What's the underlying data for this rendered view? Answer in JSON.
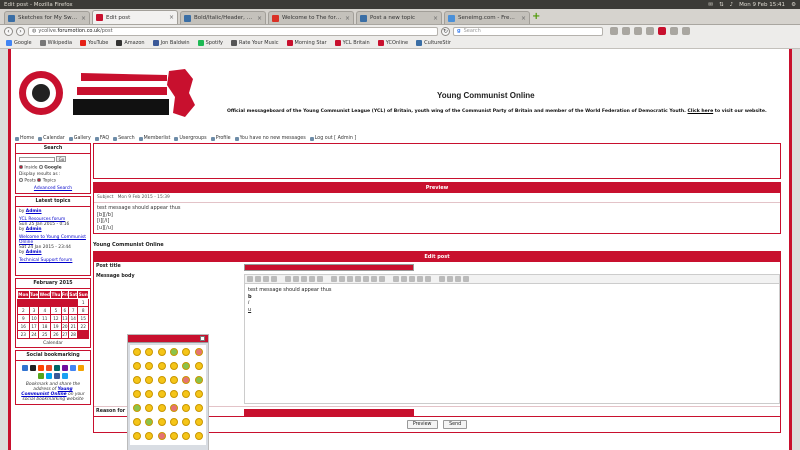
{
  "os": {
    "window_title": "Edit post - Mozilla Firefox",
    "datetime": "Mon 9 Feb 15:41"
  },
  "tabs": [
    {
      "label": "Sketches for My Sweeth...",
      "color": "#3a6ea5"
    },
    {
      "label": "Edit post",
      "color": "#c8102e",
      "active": true
    },
    {
      "label": "Bold/Italic/Header, etc ...",
      "color": "#3a6ea5"
    },
    {
      "label": "Welcome to The forum ...",
      "color": "#d93025"
    },
    {
      "label": "Post a new topic",
      "color": "#3a6ea5"
    },
    {
      "label": "Seneimg.com - Free ima...",
      "color": "#4a90d9"
    }
  ],
  "nav": {
    "url_host": "ycolive.",
    "url_domain": "forumotion.co.uk",
    "url_path": "/post",
    "search_placeholder": "Search"
  },
  "bookmarks": [
    {
      "label": "Google",
      "color": "#4285f4"
    },
    {
      "label": "Wikipedia",
      "color": "#777777"
    },
    {
      "label": "YouTube",
      "color": "#e62117"
    },
    {
      "label": "Amazon",
      "color": "#333333"
    },
    {
      "label": "Jon Baldwin",
      "color": "#3b5998"
    },
    {
      "label": "Spotify",
      "color": "#1db954"
    },
    {
      "label": "Rate Your Music",
      "color": "#555555"
    },
    {
      "label": "Morning Star",
      "color": "#c8102e"
    },
    {
      "label": "YCL Britain",
      "color": "#c8102e"
    },
    {
      "label": "YCOnline",
      "color": "#c8102e"
    },
    {
      "label": "CultureStir",
      "color": "#3a6ea5"
    }
  ],
  "site": {
    "title": "Young Communist Online",
    "desc": "Official messageboard of the Young Communist League (YCL) of Britain, youth wing of the Communist Party of Britain and member of the World Federation of Democratic Youth.",
    "desc_link": "Click here",
    "desc_tail": " to visit our website."
  },
  "menu": [
    "Home",
    "Calendar",
    "Gallery",
    "FAQ",
    "Search",
    "Memberlist",
    "Usergroups",
    "Profile",
    "You have no new messages",
    "Log out [ Admin ]"
  ],
  "sidebar": {
    "search": {
      "title": "Search",
      "go": "Go",
      "inside": "Inside",
      "google": "Google",
      "display": "Display results as :",
      "posts": "Posts",
      "topics": "Topics",
      "advanced": "Advanced Search"
    },
    "latest": {
      "title": "Latest topics",
      "items": [
        {
          "by": "by",
          "user": "Admin",
          "topic": "",
          "date": ""
        },
        {
          "topic": "YCL Resources forum",
          "date": "Sun 25 Jan 2015 - 0:16",
          "by": "by",
          "user": "Admin"
        },
        {
          "topic": "Welcome to Young Communist Online",
          "date": "Sat 24 Jan 2015 - 23:44",
          "by": "by",
          "user": "Admin"
        },
        {
          "topic": "Technical Support forum",
          "date": "",
          "by": "",
          "user": ""
        }
      ]
    },
    "calendar": {
      "title": "February 2015",
      "days": [
        "Mon",
        "Tue",
        "Wed",
        "Thu",
        "Fri",
        "Sat",
        "Sun"
      ],
      "weeks": [
        [
          "",
          "",
          "",
          "",
          "",
          "",
          "1"
        ],
        [
          "2",
          "3",
          "4",
          "5",
          "6",
          "7",
          "8"
        ],
        [
          "9",
          "10",
          "11",
          "12",
          "13",
          "14",
          "15"
        ],
        [
          "16",
          "17",
          "18",
          "19",
          "20",
          "21",
          "22"
        ],
        [
          "23",
          "24",
          "25",
          "26",
          "27",
          "28",
          ""
        ]
      ],
      "footer": "Calendar"
    },
    "social": {
      "title": "Social bookmarking",
      "text1": "Bookmark and share the address of ",
      "link": "Young Communist Online",
      "text2": " on your social bookmarking website"
    }
  },
  "preview": {
    "title": "Preview",
    "subject_label": "Subject",
    "subject_date": "Mon 9 Feb 2015 - 15:39",
    "lines": [
      "test message should appear thus",
      "[b][/b]",
      "[i][/i]",
      "[u][/u]"
    ]
  },
  "forum_name": "Young Communist Online",
  "edit": {
    "title": "Edit post",
    "post_title_label": "Post title",
    "message_label": "Message body",
    "body_lines": [
      "test message should appear thus",
      "b",
      "i",
      "u"
    ],
    "reason_label": "Reason for editing",
    "preview_btn": "Preview",
    "send_btn": "Send"
  },
  "colors": {
    "accent": "#c8102e"
  }
}
